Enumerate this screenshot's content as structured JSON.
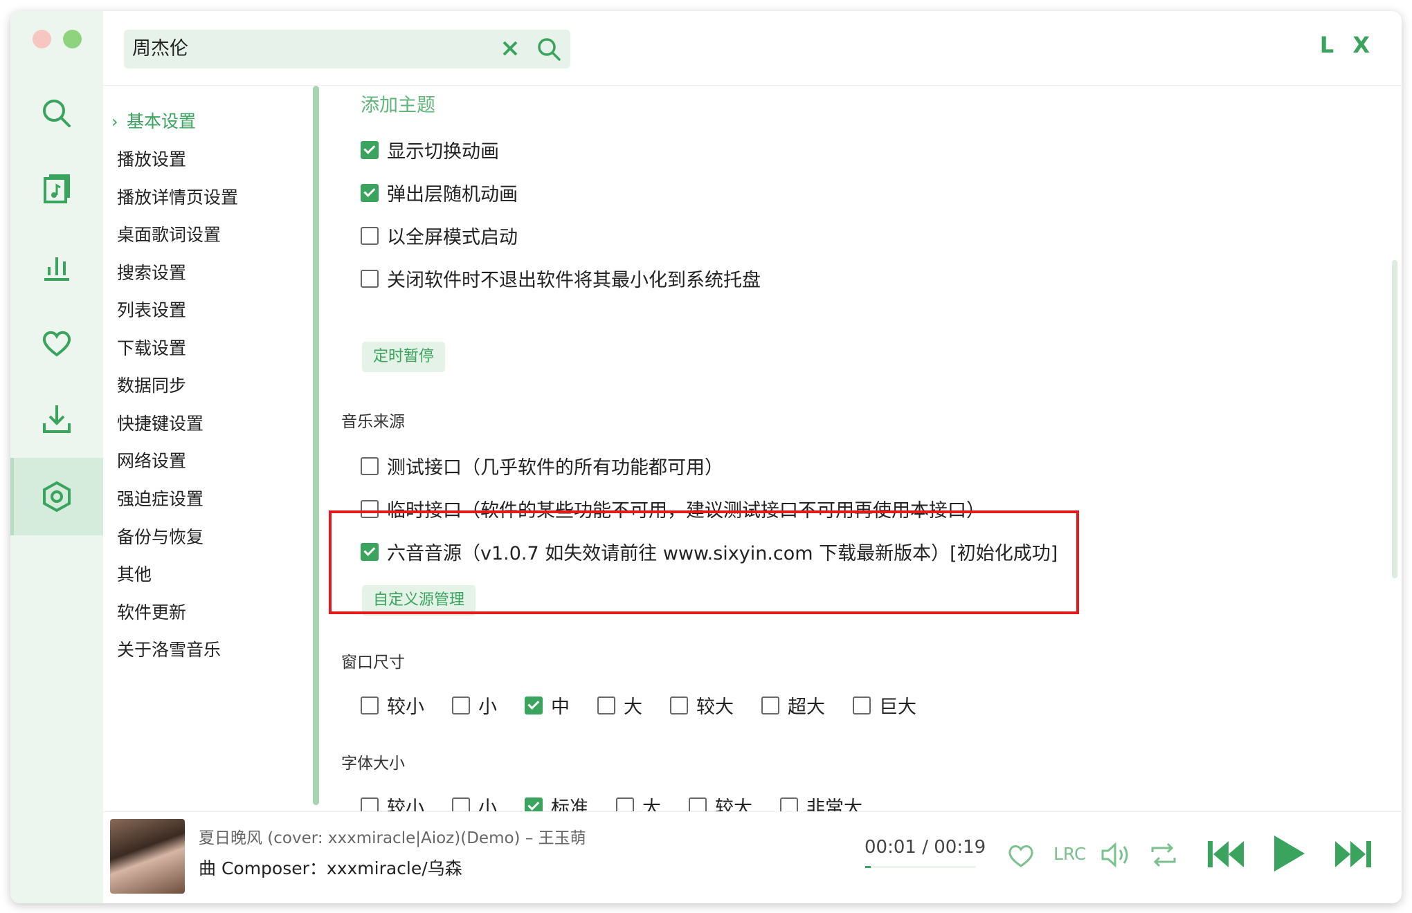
{
  "brand": "L X",
  "search": {
    "value": "周杰伦"
  },
  "nav": {
    "items": [
      {
        "label": "基本设置",
        "active": true
      },
      {
        "label": "播放设置"
      },
      {
        "label": "播放详情页设置"
      },
      {
        "label": "桌面歌词设置"
      },
      {
        "label": "搜索设置"
      },
      {
        "label": "列表设置"
      },
      {
        "label": "下载设置"
      },
      {
        "label": "数据同步"
      },
      {
        "label": "快捷键设置"
      },
      {
        "label": "网络设置"
      },
      {
        "label": "强迫症设置"
      },
      {
        "label": "备份与恢复"
      },
      {
        "label": "其他"
      },
      {
        "label": "软件更新"
      },
      {
        "label": "关于洛雪音乐"
      }
    ]
  },
  "settings": {
    "add_theme": "添加主题",
    "ui_options": [
      {
        "label": "显示切换动画",
        "checked": true
      },
      {
        "label": "弹出层随机动画",
        "checked": true
      },
      {
        "label": "以全屏模式启动",
        "checked": false
      },
      {
        "label": "关闭软件时不退出软件将其最小化到系统托盘",
        "checked": false
      }
    ],
    "timer_button": "定时暂停",
    "music_source": {
      "title": "音乐来源",
      "options": [
        {
          "label": "测试接口（几乎软件的所有功能都可用）",
          "checked": false
        },
        {
          "label": "临时接口（软件的某些功能不可用，建议测试接口不可用再使用本接口）",
          "checked": false
        },
        {
          "label": "六音音源（v1.0.7 如失效请前往 www.sixyin.com 下载最新版本）[初始化成功]",
          "checked": true
        }
      ],
      "custom_button": "自定义源管理"
    },
    "window_size": {
      "title": "窗口尺寸",
      "options": [
        {
          "label": "较小",
          "checked": false
        },
        {
          "label": "小",
          "checked": false
        },
        {
          "label": "中",
          "checked": true
        },
        {
          "label": "大",
          "checked": false
        },
        {
          "label": "较大",
          "checked": false
        },
        {
          "label": "超大",
          "checked": false
        },
        {
          "label": "巨大",
          "checked": false
        }
      ]
    },
    "font_size": {
      "title": "字体大小",
      "options": [
        {
          "label": "较小",
          "checked": false
        },
        {
          "label": "小",
          "checked": false
        },
        {
          "label": "标准",
          "checked": true
        },
        {
          "label": "大",
          "checked": false
        },
        {
          "label": "较大",
          "checked": false
        },
        {
          "label": "非常大",
          "checked": false
        }
      ]
    }
  },
  "player": {
    "title": "夏日晚风 (cover: xxxmiracle|Aioz)(Demo) – 王玉萌",
    "lyric": "曲 Composer：xxxmiracle/乌森",
    "time_current": "00:01",
    "time_separator": "/",
    "time_total": "00:19",
    "progress": 0.05,
    "lrc_label": "LRC"
  },
  "colors": {
    "accent": "#3aa35d",
    "highlight_box": "#e11b1b"
  },
  "icons": [
    "search-icon",
    "music-list-icon",
    "chart-icon",
    "heart-icon",
    "download-icon",
    "settings-icon",
    "clear-icon",
    "prev-icon",
    "play-icon",
    "next-icon",
    "repeat-icon",
    "volume-icon"
  ]
}
